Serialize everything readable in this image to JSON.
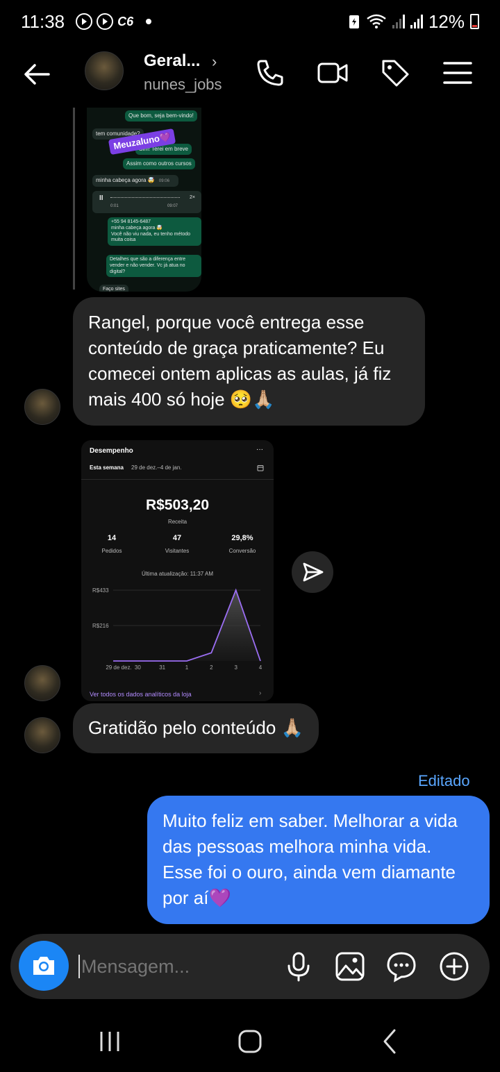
{
  "status_bar": {
    "time": "11:38",
    "carrier_badge": "C6",
    "battery": "12%",
    "icons": [
      "shazam-icon",
      "shazam-icon",
      "dot",
      "battery-saver-icon",
      "wifi-icon",
      "signal-icon",
      "signal-icon",
      "battery-icon"
    ]
  },
  "header": {
    "name": "Geral...",
    "username": "nunes_jobs",
    "chevron": "›"
  },
  "wa_screenshot": {
    "messages": [
      {
        "text": "Que bom, seja bem-vindo!",
        "dir": "out"
      },
      {
        "text": "tem comunidade?",
        "dir": "in"
      },
      {
        "text": "Sim! Terei em breve",
        "dir": "out"
      },
      {
        "text": "Assim como outros cursos",
        "dir": "out"
      },
      {
        "text": "minha cabeça agora 🤯",
        "dir": "in",
        "time": "09:06"
      },
      {
        "text": "0:01",
        "dir": "in",
        "audio": true,
        "speed": "2×",
        "time": "09:07"
      },
      {
        "text": "+55 94 8145-6487\nminha cabeça agora 🤯\nVocê não viu nada, eu tenho método\nmuita coisa",
        "dir": "out"
      },
      {
        "text": "Detalhes que são a diferença entre\nvender e não vender. Vc já atua no\ndigital?",
        "dir": "out"
      },
      {
        "text": "Faço sites",
        "dir": "in"
      }
    ],
    "sticker": "Meuzaluno💜"
  },
  "messages": {
    "m1": "Rangel, porque você entrega esse conteúdo de graça praticamente? Eu comecei ontem aplicas as aulas, já fiz mais 400 só hoje 🥺🙏🏼",
    "m2": "Gratidão pelo conteúdo 🙏🏼",
    "m3": "Muito feliz em saber. Melhorar a vida das pessoas melhora minha vida. Esse foi o ouro, ainda vem diamante por aí💜",
    "edited": "Editado"
  },
  "dashboard": {
    "title": "Desempenho",
    "more": "···",
    "period_label": "Esta semana",
    "period_range": "29 de dez.–4 de jan.",
    "revenue": "R$503,20",
    "revenue_label": "Receita",
    "stats": [
      {
        "value": "14",
        "label": "Pedidos"
      },
      {
        "value": "47",
        "label": "Visitantes"
      },
      {
        "value": "29,8%",
        "label": "Conversão"
      }
    ],
    "updated": "Última atualização: 11:37 AM",
    "footer_link": "Ver todos os dados analíticos da loja",
    "chart_data": {
      "type": "area",
      "categories": [
        "29 de dez.",
        "30",
        "31",
        "1",
        "2",
        "3",
        "4"
      ],
      "values": [
        0,
        0,
        0,
        0,
        50,
        433,
        0
      ],
      "yticks": [
        "R$433",
        "R$216"
      ],
      "ylim": [
        0,
        433
      ],
      "color": "#9b6ef3"
    }
  },
  "composer": {
    "placeholder": "Mensagem..."
  },
  "colors": {
    "background": "#000000",
    "incoming_bubble": "#262626",
    "outgoing_bubble": "#3578f0",
    "edited_text": "#5aa7ff",
    "camera_button": "#1b86f5"
  }
}
